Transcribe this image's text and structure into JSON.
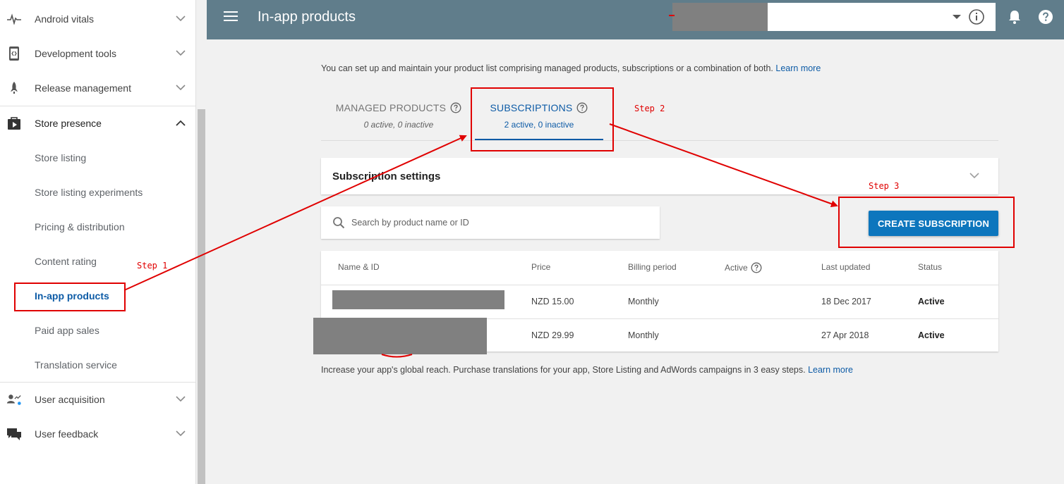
{
  "sidebar": {
    "items": [
      {
        "label": "Android vitals",
        "icon": "vitals-icon"
      },
      {
        "label": "Development tools",
        "icon": "dev-tools-icon"
      },
      {
        "label": "Release management",
        "icon": "rocket-icon"
      },
      {
        "label": "Store presence",
        "icon": "store-icon"
      }
    ],
    "store_presence_sub": [
      "Store listing",
      "Store listing experiments",
      "Pricing & distribution",
      "Content rating",
      "In-app products",
      "Paid app sales",
      "Translation service"
    ],
    "bottom_items": [
      {
        "label": "User acquisition",
        "icon": "user-acquisition-icon"
      },
      {
        "label": "User feedback",
        "icon": "feedback-icon"
      }
    ]
  },
  "topbar": {
    "title": "In-app products"
  },
  "main": {
    "intro": "You can set up and maintain your product list comprising managed products, subscriptions or a combination of both.",
    "intro_link": "Learn more",
    "tabs": [
      {
        "label": "MANAGED PRODUCTS",
        "sub": "0 active, 0 inactive"
      },
      {
        "label": "SUBSCRIPTIONS",
        "sub": "2 active, 0 inactive"
      }
    ],
    "settings_title": "Subscription settings",
    "search_placeholder": "Search by product name or ID",
    "create_button": "CREATE SUBSCRIPTION",
    "table": {
      "headers": [
        "Name & ID",
        "Price",
        "Billing period",
        "Active",
        "Last updated",
        "Status"
      ],
      "rows": [
        {
          "price": "NZD 15.00",
          "billing": "Monthly",
          "updated": "18 Dec 2017",
          "status": "Active"
        },
        {
          "price": "NZD 29.99",
          "billing": "Monthly",
          "updated": "27 Apr 2018",
          "status": "Active"
        }
      ]
    },
    "footer": "Increase your app's global reach. Purchase translations for your app, Store Listing and AdWords campaigns in 3 easy steps.",
    "footer_link": "Learn more"
  },
  "annotations": {
    "step1": "Step 1",
    "step2": "Step 2",
    "step3": "Step 3",
    "color": "#e00000"
  },
  "colors": {
    "topbar": "#607d8b",
    "accent": "#0d5ba6",
    "button": "#0d76bd"
  }
}
